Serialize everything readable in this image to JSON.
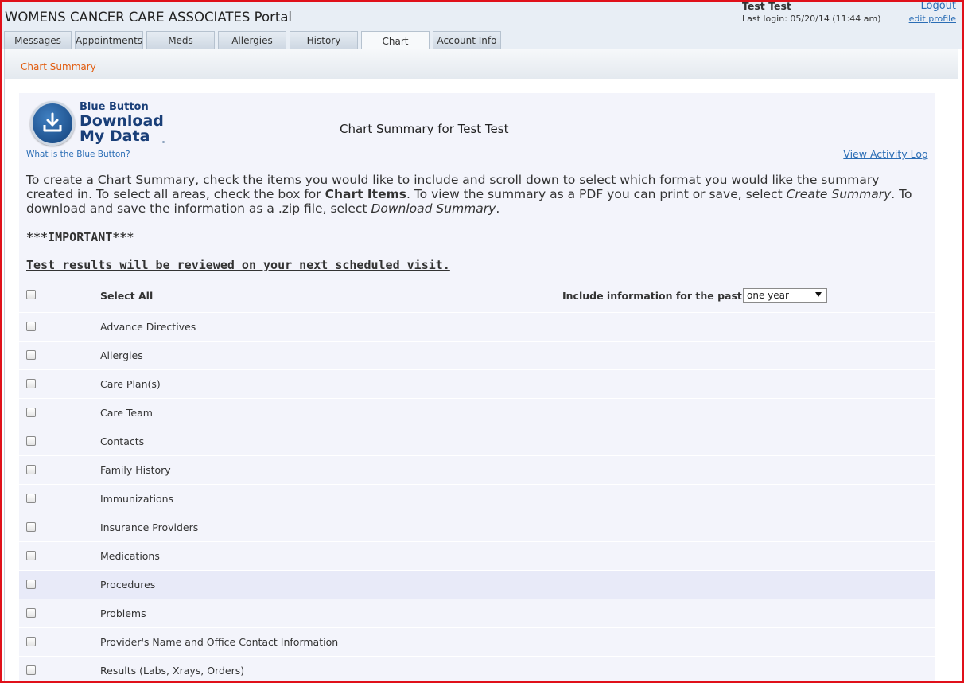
{
  "header": {
    "portal_title": "WOMENS CANCER CARE ASSOCIATES Portal",
    "user_name": "Test Test",
    "last_login": "Last login: 05/20/14 (11:44 am)",
    "logout_label": "Logout",
    "edit_profile_label": "edit profile"
  },
  "tabs": [
    {
      "label": "Messages"
    },
    {
      "label": "Appointments"
    },
    {
      "label": "Meds"
    },
    {
      "label": "Allergies"
    },
    {
      "label": "History"
    },
    {
      "label": "Chart",
      "active": true
    },
    {
      "label": "Account Info"
    }
  ],
  "breadcrumb": "Chart Summary",
  "blue_button": {
    "line1": "Blue Button",
    "line2": "Download",
    "line3": "My Data",
    "help_link": "What is the Blue Button?"
  },
  "chart_title": "Chart Summary for Test Test",
  "activity_log_label": "View Activity Log",
  "instructions": {
    "part1": "To create a Chart Summary, check the items you would like to include and scroll down to select which format you would like the summary created in. To select all areas, check the box for ",
    "bold1": "Chart Items",
    "part2": ". To view the summary as a PDF you can print or save, select ",
    "italic1": "Create Summary",
    "part3": ". To download and save the information as a .zip file, select ",
    "italic2": "Download Summary",
    "part4": "."
  },
  "important_label": "***IMPORTANT***",
  "test_notice": "Test results will be reviewed on your next scheduled visit.",
  "select_all_label": "Select All",
  "include_label": "Include information for the past",
  "time_range": {
    "selected": "one year"
  },
  "items": [
    {
      "label": "Advance Directives"
    },
    {
      "label": "Allergies"
    },
    {
      "label": "Care Plan(s)"
    },
    {
      "label": "Care Team"
    },
    {
      "label": "Contacts"
    },
    {
      "label": "Family History"
    },
    {
      "label": "Immunizations"
    },
    {
      "label": "Insurance Providers"
    },
    {
      "label": "Medications"
    },
    {
      "label": "Procedures",
      "highlighted": true
    },
    {
      "label": "Problems"
    },
    {
      "label": "Provider's Name and Office Contact Information"
    },
    {
      "label": "Results (Labs, Xrays, Orders)"
    }
  ],
  "colors": {
    "link": "#2a6db5",
    "breadcrumb": "#e25d10",
    "logo_blue": "#1a3f78",
    "frame": "#e0101a"
  }
}
